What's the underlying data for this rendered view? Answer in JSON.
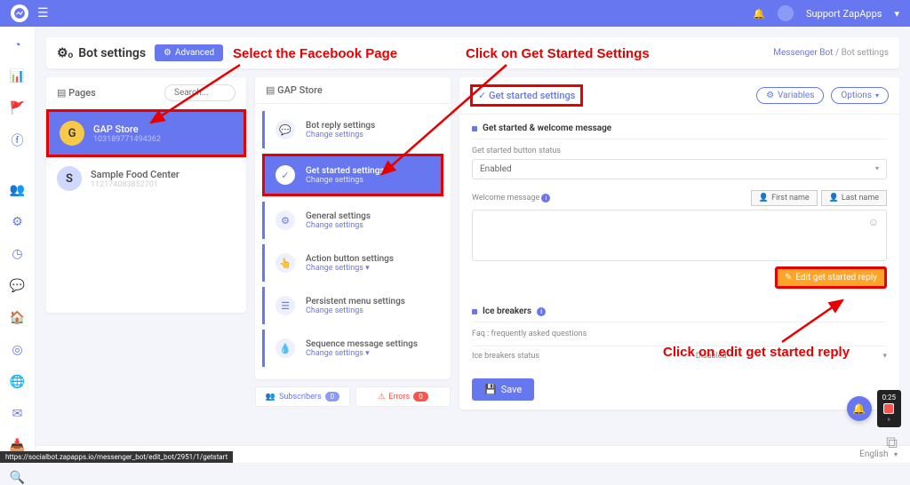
{
  "topbar": {
    "user_label": "Support ZapApps",
    "user_caret": "▾"
  },
  "header": {
    "title": "Bot settings",
    "advanced_label": "Advanced",
    "breadcrumb_link": "Messenger Bot",
    "breadcrumb_sep": "/",
    "breadcrumb_current": "Bot settings"
  },
  "pages": {
    "header": "Pages",
    "search_placeholder": "Search...",
    "items": [
      {
        "initial": "G",
        "name": "GAP Store",
        "id": "103189771494362"
      },
      {
        "initial": "S",
        "name": "Sample Food Center",
        "id": "112174083852701"
      }
    ]
  },
  "sections": {
    "header": "GAP Store",
    "items": [
      {
        "title": "Bot reply settings",
        "sub": "Change settings"
      },
      {
        "title": "Get started settings",
        "sub": "Change settings"
      },
      {
        "title": "General settings",
        "sub": "Change settings"
      },
      {
        "title": "Action button settings",
        "sub": "Change settings ▾"
      },
      {
        "title": "Persistent menu settings",
        "sub": "Change settings"
      },
      {
        "title": "Sequence message settings",
        "sub": "Change settings ▾"
      }
    ],
    "subscribers_label": "Subscribers",
    "subscribers_count": "0",
    "errors_label": "Errors",
    "errors_count": "0"
  },
  "panel": {
    "title": "Get started settings",
    "variables_btn": "Variables",
    "options_btn": "Options",
    "get_started_heading": "Get started & welcome message",
    "status_label": "Get started button status",
    "status_value": "Enabled",
    "welcome_label": "Welcome message",
    "firstname_btn": "First name",
    "lastname_btn": "Last name",
    "edit_btn": "Edit get started reply",
    "ice_heading": "Ice breakers",
    "ice_sub": "Faq : frequently asked questions",
    "ice_status_label": "Ice breakers status",
    "ice_status_value": "Disabled",
    "save_btn": "Save"
  },
  "annotations": {
    "a1": "Select the Facebook Page",
    "a2": "Click on Get Started Settings",
    "a3": "Click on edit get started reply"
  },
  "footer": {
    "lang": "English"
  },
  "statusbar": "https://socialbot.zapapps.io/messenger_bot/edit_bot/2951/1/getstart",
  "recorder": {
    "time": "0:25"
  },
  "colors": {
    "primary": "#6777ef",
    "danger": "#fc544b",
    "warning": "#ffa426",
    "annotation": "#e60000"
  }
}
